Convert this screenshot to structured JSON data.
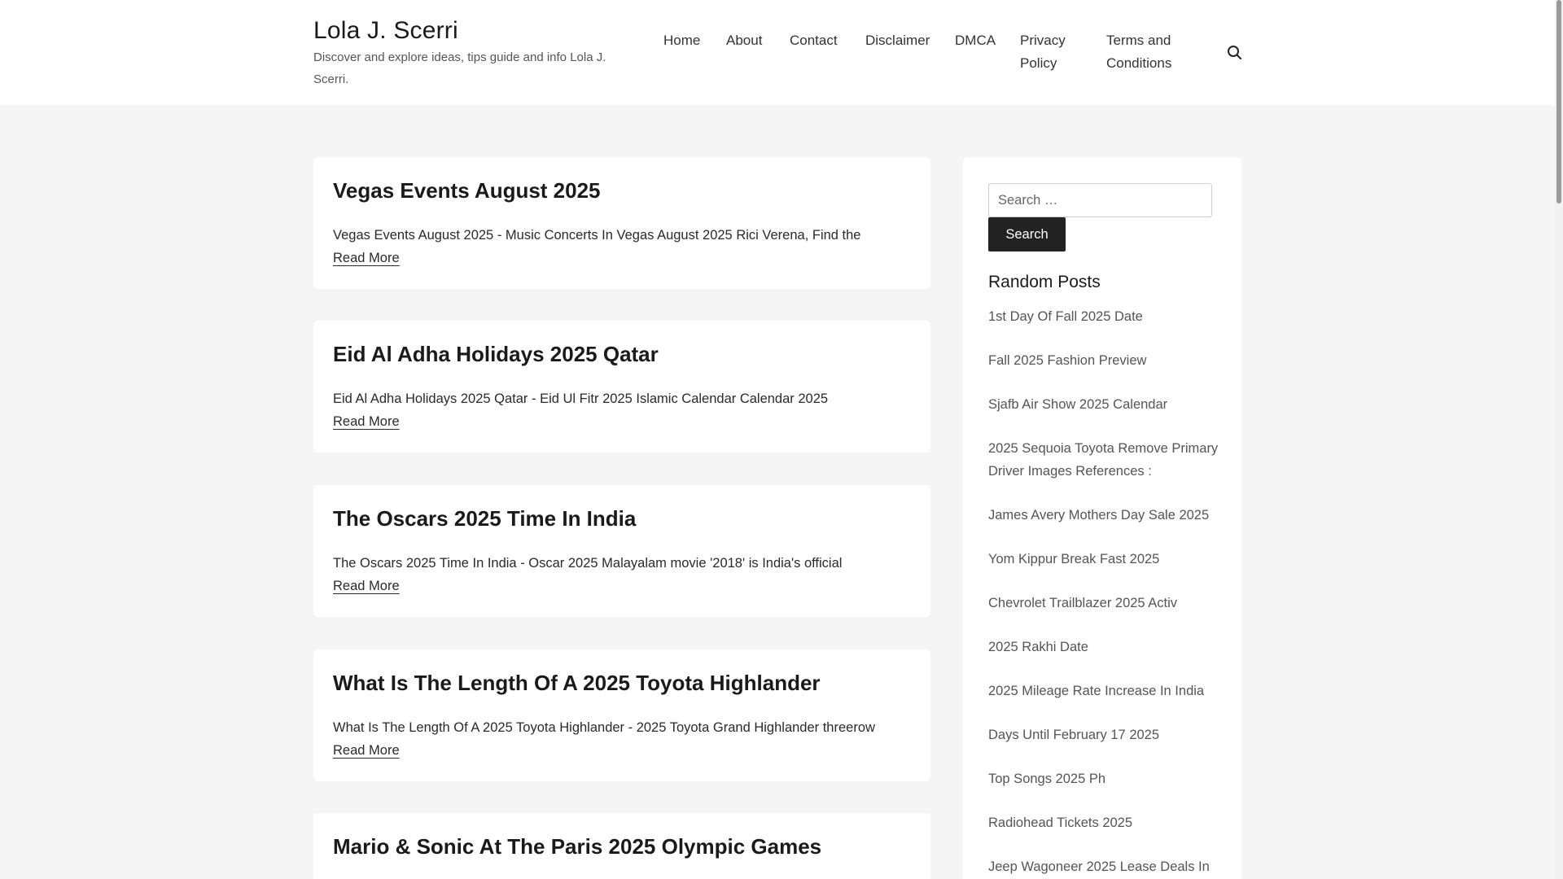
{
  "site": {
    "title": "Lola J. Scerri",
    "description": "Discover and explore ideas, tips guide and info Lola J. Scerri."
  },
  "nav": {
    "home": "Home",
    "about": "About",
    "contact": "Contact",
    "disclaimer": "Disclaimer",
    "dmca": "DMCA",
    "privacy_line1": "Privacy",
    "privacy_line2": "Policy",
    "terms_line1": "Terms and",
    "terms_line2": "Conditions",
    "search_icon": "search-icon"
  },
  "posts": [
    {
      "title": "Vegas Events August 2025",
      "excerpt": "Vegas Events August 2025 - Music Concerts In Vegas August 2025 Rici Verena, Find the",
      "read_more": "Read More"
    },
    {
      "title": "Eid Al Adha Holidays 2025 Qatar",
      "excerpt": "Eid Al Adha Holidays 2025 Qatar - Eid Ul Fitr 2025 Islamic Calendar Calendar 2025",
      "read_more": "Read More"
    },
    {
      "title": "The Oscars 2025 Time In India",
      "excerpt": "The Oscars 2025 Time In India - Oscar 2025 Malayalam movie '2018' is India's official",
      "read_more": "Read More"
    },
    {
      "title": "What Is The Length Of A 2025 Toyota Highlander",
      "excerpt": "What Is The Length Of A 2025 Toyota Highlander - 2025 Toyota Grand Highlander threerow",
      "read_more": "Read More"
    },
    {
      "title": "Mario & Sonic At The Paris 2025 Olympic Games"
    }
  ],
  "sidebar": {
    "search_placeholder": "Search …",
    "search_button": "Search",
    "random_title": "Random Posts",
    "random_posts": [
      "1st Day Of Fall 2025 Date",
      "Fall 2025 Fashion Preview",
      "Sjafb Air Show 2025 Calendar",
      "2025 Sequoia Toyota Remove Primary Driver Images References :",
      "James Avery Mothers Day Sale 2025",
      "Yom Kippur Break Fast 2025",
      "Chevrolet Trailblazer 2025 Activ",
      "2025 Rakhi Date",
      "2025 Mileage Rate Increase In India",
      "Days Until February 17 2025",
      "Top Songs 2025 Ph",
      "Radiohead Tickets 2025",
      "Jeep Wagoneer 2025 Lease Deals In"
    ]
  }
}
